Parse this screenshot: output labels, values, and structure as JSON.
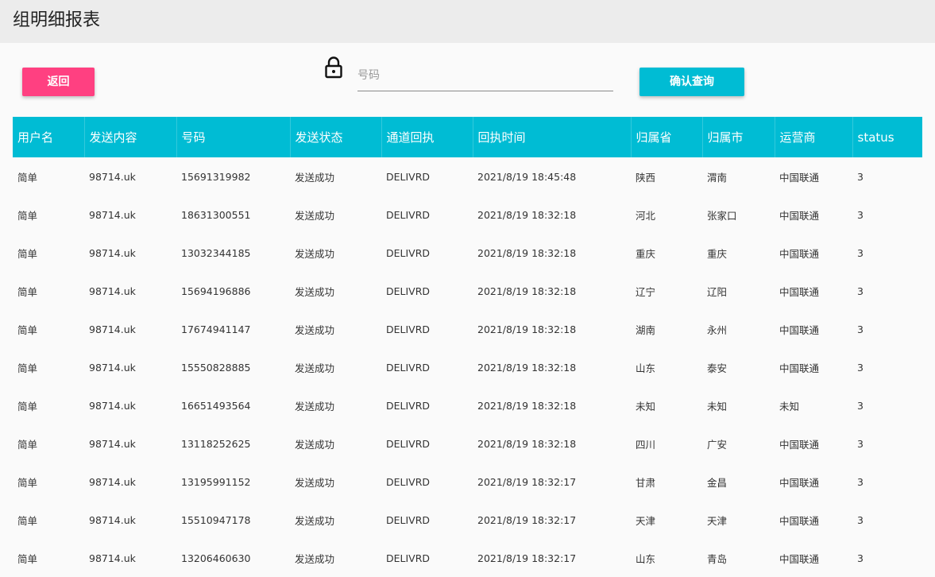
{
  "header": {
    "title": "组明细报表"
  },
  "toolbar": {
    "back_label": "返回",
    "search_placeholder": "号码",
    "search_value": "",
    "query_label": "确认查询",
    "lock_icon": "lock-icon"
  },
  "table": {
    "columns": [
      "用户名",
      "发送内容",
      "号码",
      "发送状态",
      "通道回执",
      "回执时间",
      "归属省",
      "归属市",
      "运营商",
      "status"
    ],
    "rows": [
      [
        "简单",
        "98714.uk",
        "15691319982",
        "发送成功",
        "DELIVRD",
        "2021/8/19 18:45:48",
        "陕西",
        "渭南",
        "中国联通",
        "3"
      ],
      [
        "简单",
        "98714.uk",
        "18631300551",
        "发送成功",
        "DELIVRD",
        "2021/8/19 18:32:18",
        "河北",
        "张家口",
        "中国联通",
        "3"
      ],
      [
        "简单",
        "98714.uk",
        "13032344185",
        "发送成功",
        "DELIVRD",
        "2021/8/19 18:32:18",
        "重庆",
        "重庆",
        "中国联通",
        "3"
      ],
      [
        "简单",
        "98714.uk",
        "15694196886",
        "发送成功",
        "DELIVRD",
        "2021/8/19 18:32:18",
        "辽宁",
        "辽阳",
        "中国联通",
        "3"
      ],
      [
        "简单",
        "98714.uk",
        "17674941147",
        "发送成功",
        "DELIVRD",
        "2021/8/19 18:32:18",
        "湖南",
        "永州",
        "中国联通",
        "3"
      ],
      [
        "简单",
        "98714.uk",
        "15550828885",
        "发送成功",
        "DELIVRD",
        "2021/8/19 18:32:18",
        "山东",
        "泰安",
        "中国联通",
        "3"
      ],
      [
        "简单",
        "98714.uk",
        "16651493564",
        "发送成功",
        "DELIVRD",
        "2021/8/19 18:32:18",
        "未知",
        "未知",
        "未知",
        "3"
      ],
      [
        "简单",
        "98714.uk",
        "13118252625",
        "发送成功",
        "DELIVRD",
        "2021/8/19 18:32:18",
        "四川",
        "广安",
        "中国联通",
        "3"
      ],
      [
        "简单",
        "98714.uk",
        "13195991152",
        "发送成功",
        "DELIVRD",
        "2021/8/19 18:32:17",
        "甘肃",
        "金昌",
        "中国联通",
        "3"
      ],
      [
        "简单",
        "98714.uk",
        "15510947178",
        "发送成功",
        "DELIVRD",
        "2021/8/19 18:32:17",
        "天津",
        "天津",
        "中国联通",
        "3"
      ],
      [
        "简单",
        "98714.uk",
        "13206460630",
        "发送成功",
        "DELIVRD",
        "2021/8/19 18:32:17",
        "山东",
        "青岛",
        "中国联通",
        "3"
      ]
    ]
  },
  "colors": {
    "accent_pink": "#ff4081",
    "accent_cyan": "#00bcd4",
    "header_bg": "#ececec"
  }
}
